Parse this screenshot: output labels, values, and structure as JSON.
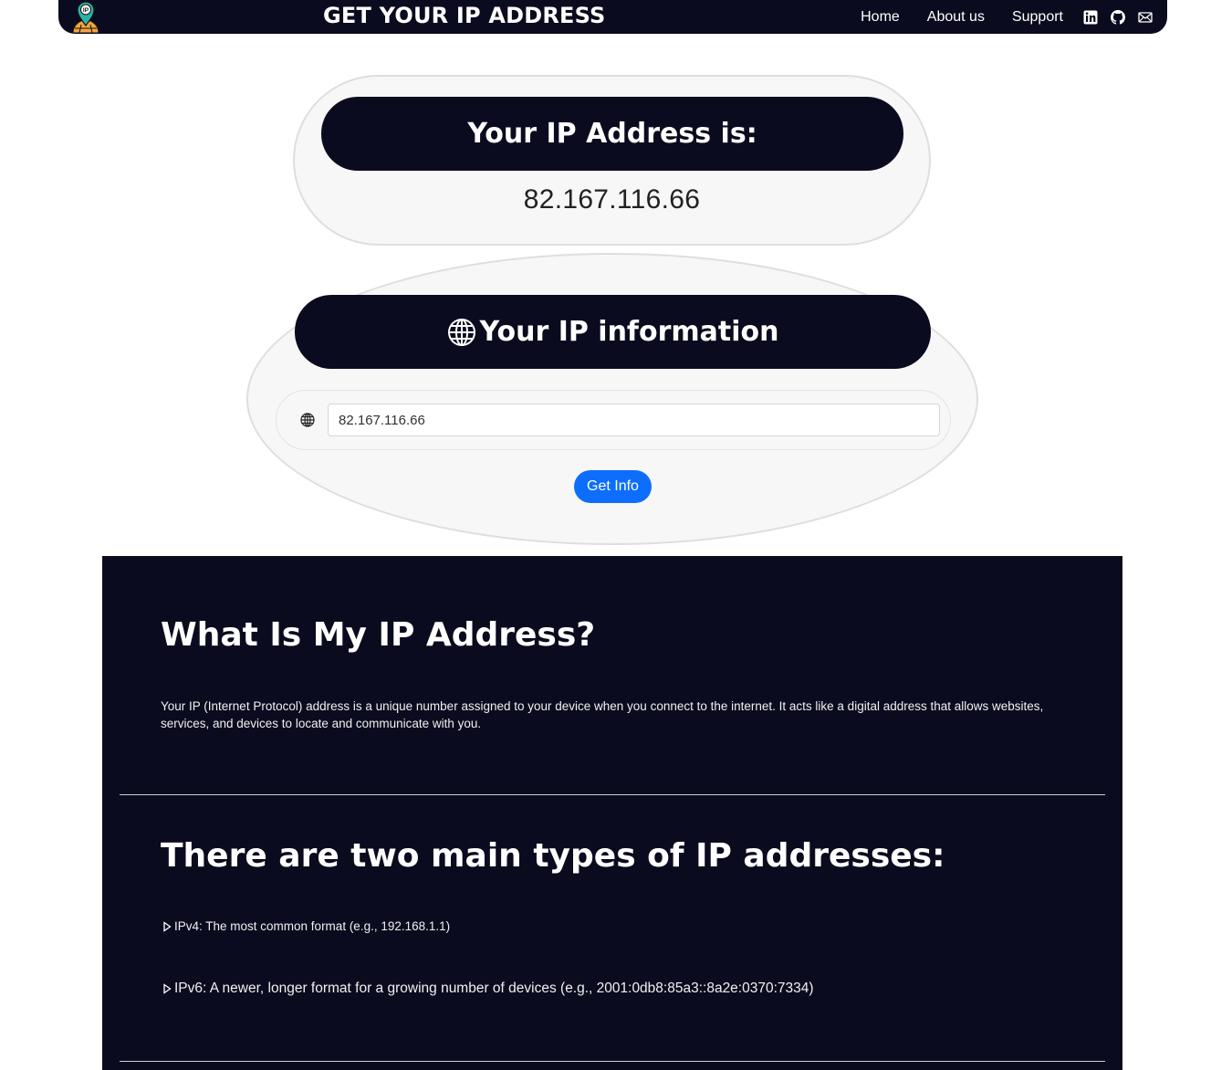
{
  "nav": {
    "title": "GET YOUR IP ADDRESS",
    "links": [
      "Home",
      "About us",
      "Support"
    ],
    "social_icons": [
      "linkedin-icon",
      "github-icon",
      "mail-icon"
    ],
    "logo_icon": "ip-location-globe-icon"
  },
  "ip_card": {
    "heading": "Your IP Address is:",
    "ip": "82.167.116.66"
  },
  "info_card": {
    "heading": "Your IP information",
    "input_value": "82.167.116.66",
    "button_label": "Get Info",
    "icon": "globe-icon"
  },
  "about": {
    "heading": "What Is My IP Address?",
    "paragraph": "Your IP (Internet Protocol) address is a unique number assigned to your device when you connect to the internet. It acts like a digital address that allows websites, services, and devices to locate and communicate with you.",
    "types_heading": "There are two main types of IP addresses:",
    "types": [
      "IPv4: The most common format (e.g., 192.168.1.1)",
      "IPv6: A newer, longer format for a growing number of devices (e.g., 2001:0db8:85a3::8a2e:0370:7334)"
    ]
  },
  "colors": {
    "dark": "#0b0b1f",
    "card_bg": "#f7f7f7",
    "button": "#0d6efd",
    "logo_teal": "#2ab3a6",
    "logo_orange": "#f4a340"
  }
}
